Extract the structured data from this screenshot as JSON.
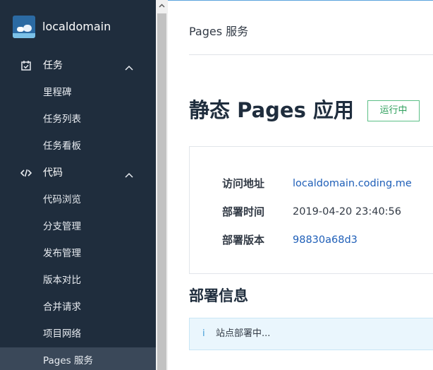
{
  "brand": {
    "name": "localdomain"
  },
  "sidebar": {
    "groups": [
      {
        "label": "任务",
        "icon": "calendar-check-icon"
      },
      {
        "label": "代码",
        "icon": "code-icon"
      }
    ],
    "task_items": [
      "里程碑",
      "任务列表",
      "任务看板"
    ],
    "code_items": [
      "代码浏览",
      "分支管理",
      "发布管理",
      "版本对比",
      "合并请求",
      "项目网络",
      "Pages 服务"
    ],
    "active_item": "Pages 服务"
  },
  "header": {
    "title": "Pages 服务"
  },
  "app": {
    "title": "静态 Pages 应用",
    "status": "运行中",
    "status_color": "#2fa05d"
  },
  "info": {
    "rows": [
      {
        "key": "访问地址",
        "value": "localdomain.coding.me"
      },
      {
        "key": "部署时间",
        "value": "2019-04-20 23:40:56"
      },
      {
        "key": "部署版本",
        "value": "98830a68d3"
      }
    ]
  },
  "deploy": {
    "title": "部署信息",
    "alert_icon": "i",
    "alert_text": "站点部署中..."
  },
  "colors": {
    "sidebar_bg": "#1f2d3d",
    "active_bg": "#3a4859",
    "link": "#1f5fb8"
  }
}
